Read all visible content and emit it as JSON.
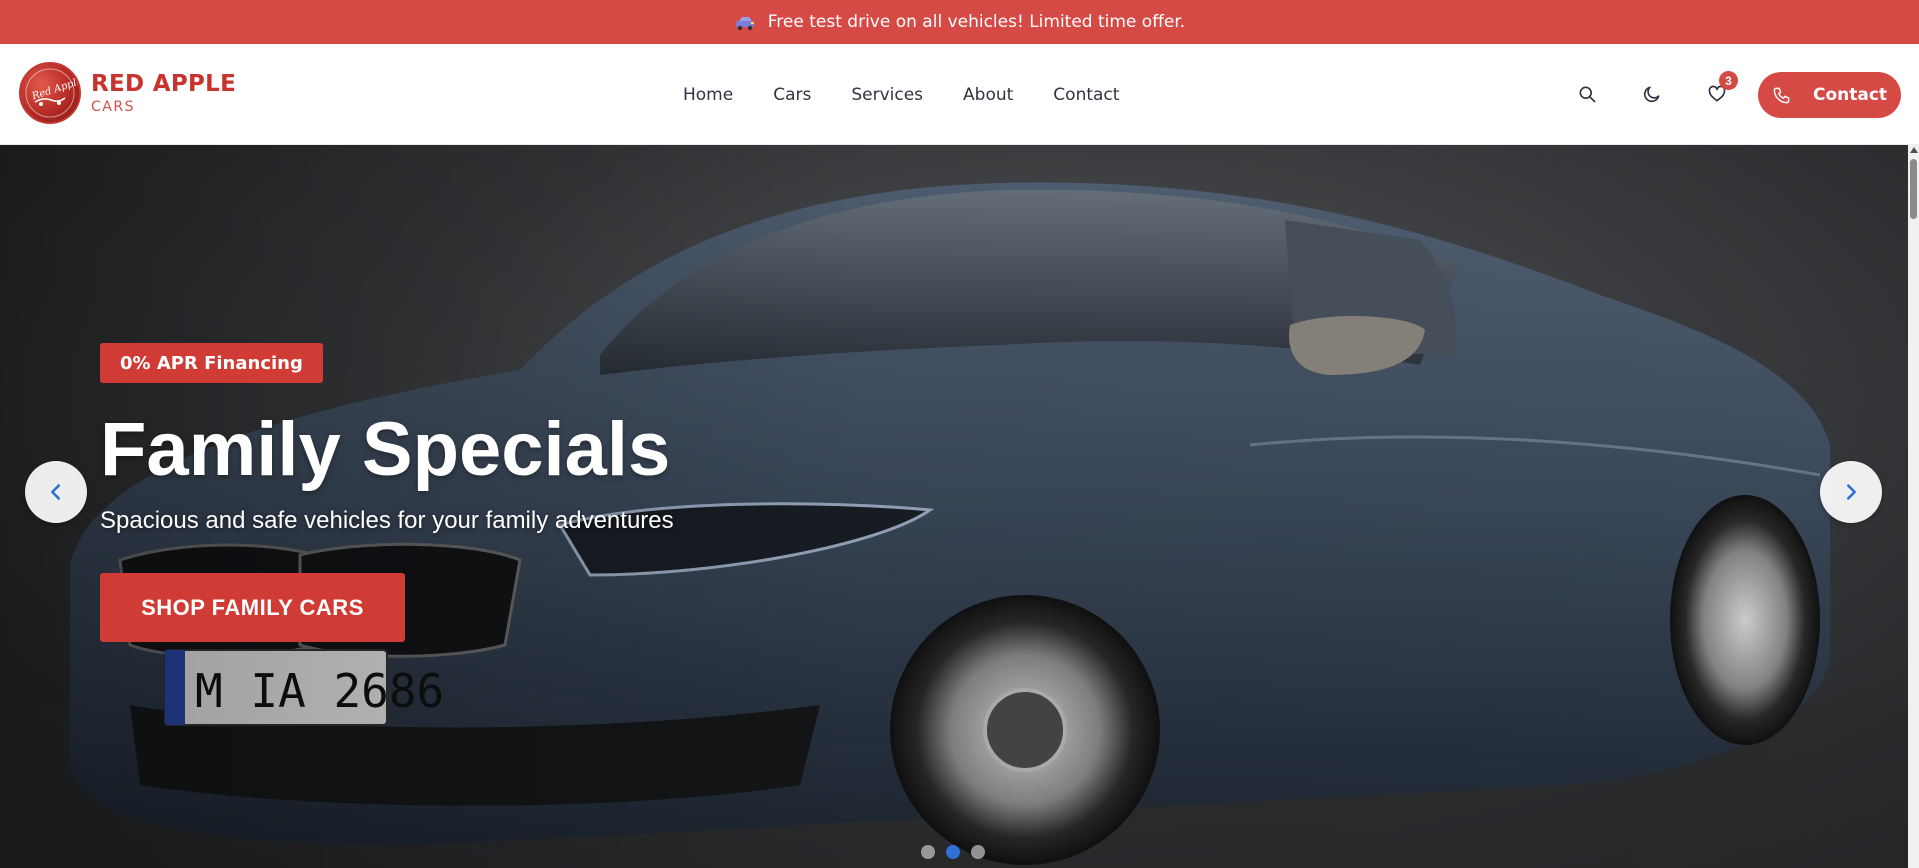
{
  "announcement": {
    "icon": "car-icon",
    "text": "Free test drive on all vehicles! Limited time offer."
  },
  "brand": {
    "name": "RED APPLE",
    "subtitle": "CARS",
    "logo_script": "Red Apple",
    "color": "#c8332d"
  },
  "nav": {
    "items": [
      {
        "label": "Home"
      },
      {
        "label": "Cars"
      },
      {
        "label": "Services"
      },
      {
        "label": "About"
      },
      {
        "label": "Contact"
      }
    ]
  },
  "header_actions": {
    "search_icon": "search-icon",
    "theme_icon": "moon-icon",
    "wishlist_icon": "heart-icon",
    "wishlist_count": "3",
    "contact_label": "Contact",
    "contact_icon": "phone-icon"
  },
  "hero": {
    "badge": "0% APR Financing",
    "title": "Family Specials",
    "subtitle": "Spacious and safe vehicles for your family adventures",
    "cta": "SHOP FAMILY CARS",
    "plate": "M IA 2686",
    "slides_total": 3,
    "active_slide": 2
  },
  "colors": {
    "accent": "#d64a46",
    "dot_active": "#2f6fd6",
    "text_dark": "#2f3440"
  }
}
